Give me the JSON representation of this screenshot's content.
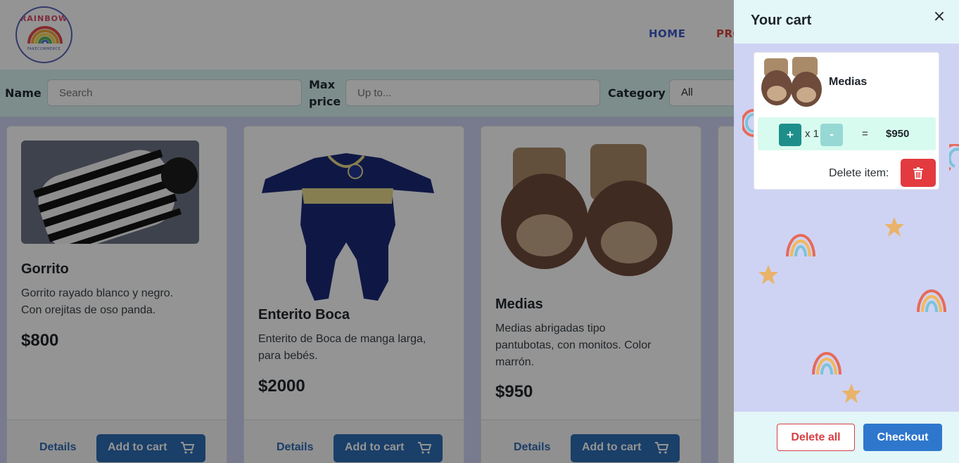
{
  "header": {
    "logo_text": "RAINBOW",
    "logo_subtext": "FAKECOMMERCE",
    "nav": {
      "home": "HOME",
      "products_partial": "PRO"
    }
  },
  "filters": {
    "name_label": "Name",
    "name_placeholder": "Search",
    "max_price_label_1": "Max",
    "max_price_label_2": "price",
    "max_price_placeholder": "Up to...",
    "category_label": "Category",
    "category_value": "All"
  },
  "products": [
    {
      "name": "Gorrito",
      "description_1": "Gorrito rayado blanco y negro.",
      "description_2": "Con orejitas de oso panda.",
      "description_3": "",
      "price": "$800"
    },
    {
      "name": "Enterito Boca",
      "description_1": "Enterito de Boca de manga larga,",
      "description_2": "para bebés.",
      "description_3": "",
      "price": "$2000"
    },
    {
      "name": "Medias",
      "description_1": "Medias abrigadas tipo",
      "description_2": "pantubotas, con monitos. Color",
      "description_3": "marrón.",
      "price": "$950"
    }
  ],
  "card_actions": {
    "details": "Details",
    "add_to_cart": "Add to cart"
  },
  "cart": {
    "title": "Your cart",
    "close_icon": "×",
    "item": {
      "name": "Medias",
      "plus": "+",
      "minus": "-",
      "qty": "x 1",
      "equals": "=",
      "subtotal": "$950"
    },
    "delete_item_label": "Delete item:",
    "delete_all": "Delete all",
    "checkout": "Checkout"
  },
  "colors": {
    "primary_blue": "#2e6db4",
    "danger_red": "#e23a3f",
    "teal": "#1e8e8a",
    "drawer_bg": "#cfd3f3"
  }
}
